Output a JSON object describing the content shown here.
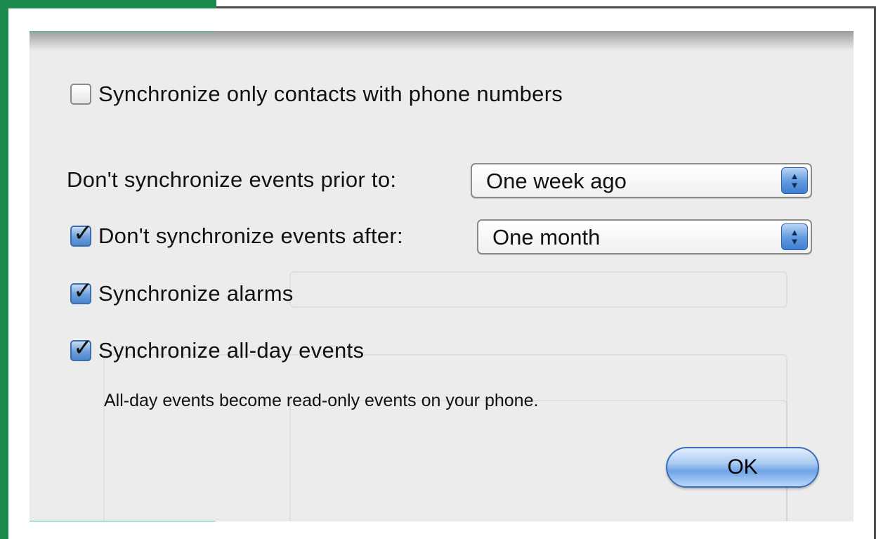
{
  "dialog": {
    "contacts_checkbox": {
      "label": "Synchronize only contacts with phone numbers",
      "checked": false
    },
    "prior_to": {
      "label": "Don't synchronize events prior to:",
      "selected": "One week ago"
    },
    "after": {
      "label": "Don't synchronize events after:",
      "selected": "One month",
      "checked": true
    },
    "alarms_checkbox": {
      "label": "Synchronize alarms",
      "checked": true
    },
    "allday_checkbox": {
      "label": "Synchronize all-day events",
      "checked": true
    },
    "allday_note": "All-day events become read-only events on your phone.",
    "ok_label": "OK"
  },
  "colors": {
    "frame_green": "#1b8a4c",
    "checkbox_blue": "#4c86cf",
    "ok_blue": "#6fa3e6"
  },
  "icons": {
    "checkmark": "checkmark-icon",
    "popup_arrows": "up-down-arrows-icon"
  }
}
